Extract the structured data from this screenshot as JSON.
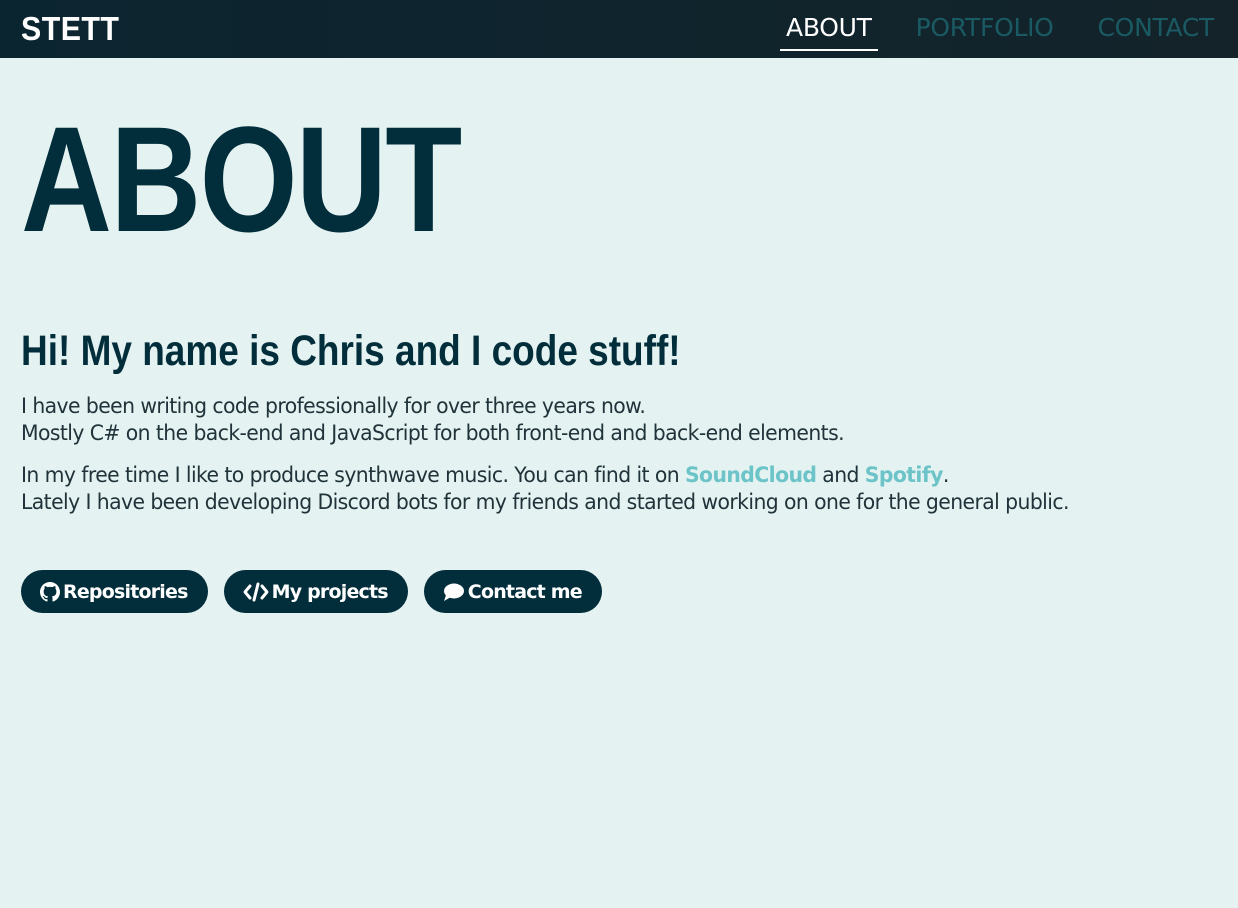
{
  "nav": {
    "brand": "STETT",
    "links": [
      {
        "label": "ABOUT",
        "active": true
      },
      {
        "label": "PORTFOLIO",
        "active": false
      },
      {
        "label": "CONTACT",
        "active": false
      }
    ]
  },
  "main": {
    "title": "ABOUT",
    "subtitle": "Hi! My name is Chris and I code stuff!",
    "para1": {
      "line1": "I have been writing code professionally for over three years now.",
      "line2": "Mostly C# on the back-end and JavaScript for both front-end and back-end elements."
    },
    "para2": {
      "line1_prefix": "In my free time I like to produce synthwave music. You can find it on ",
      "soundcloud": "SoundCloud",
      "and": " and ",
      "spotify": "Spotify",
      "line1_suffix": ".",
      "line2": "Lately I have been developing Discord bots for my friends and started working on one for the general public."
    },
    "buttons": {
      "repositories": {
        "label": "Repositories",
        "icon": "github-icon"
      },
      "projects": {
        "label": "My projects",
        "icon": "code-icon"
      },
      "contact": {
        "label": "Contact me",
        "icon": "comment-icon"
      }
    }
  },
  "colors": {
    "background": "#e4f3f1",
    "navbar": "#0b2530",
    "primary": "#022d3b",
    "link_accent": "#6cc3c8",
    "nav_inactive": "#1a5a63"
  }
}
